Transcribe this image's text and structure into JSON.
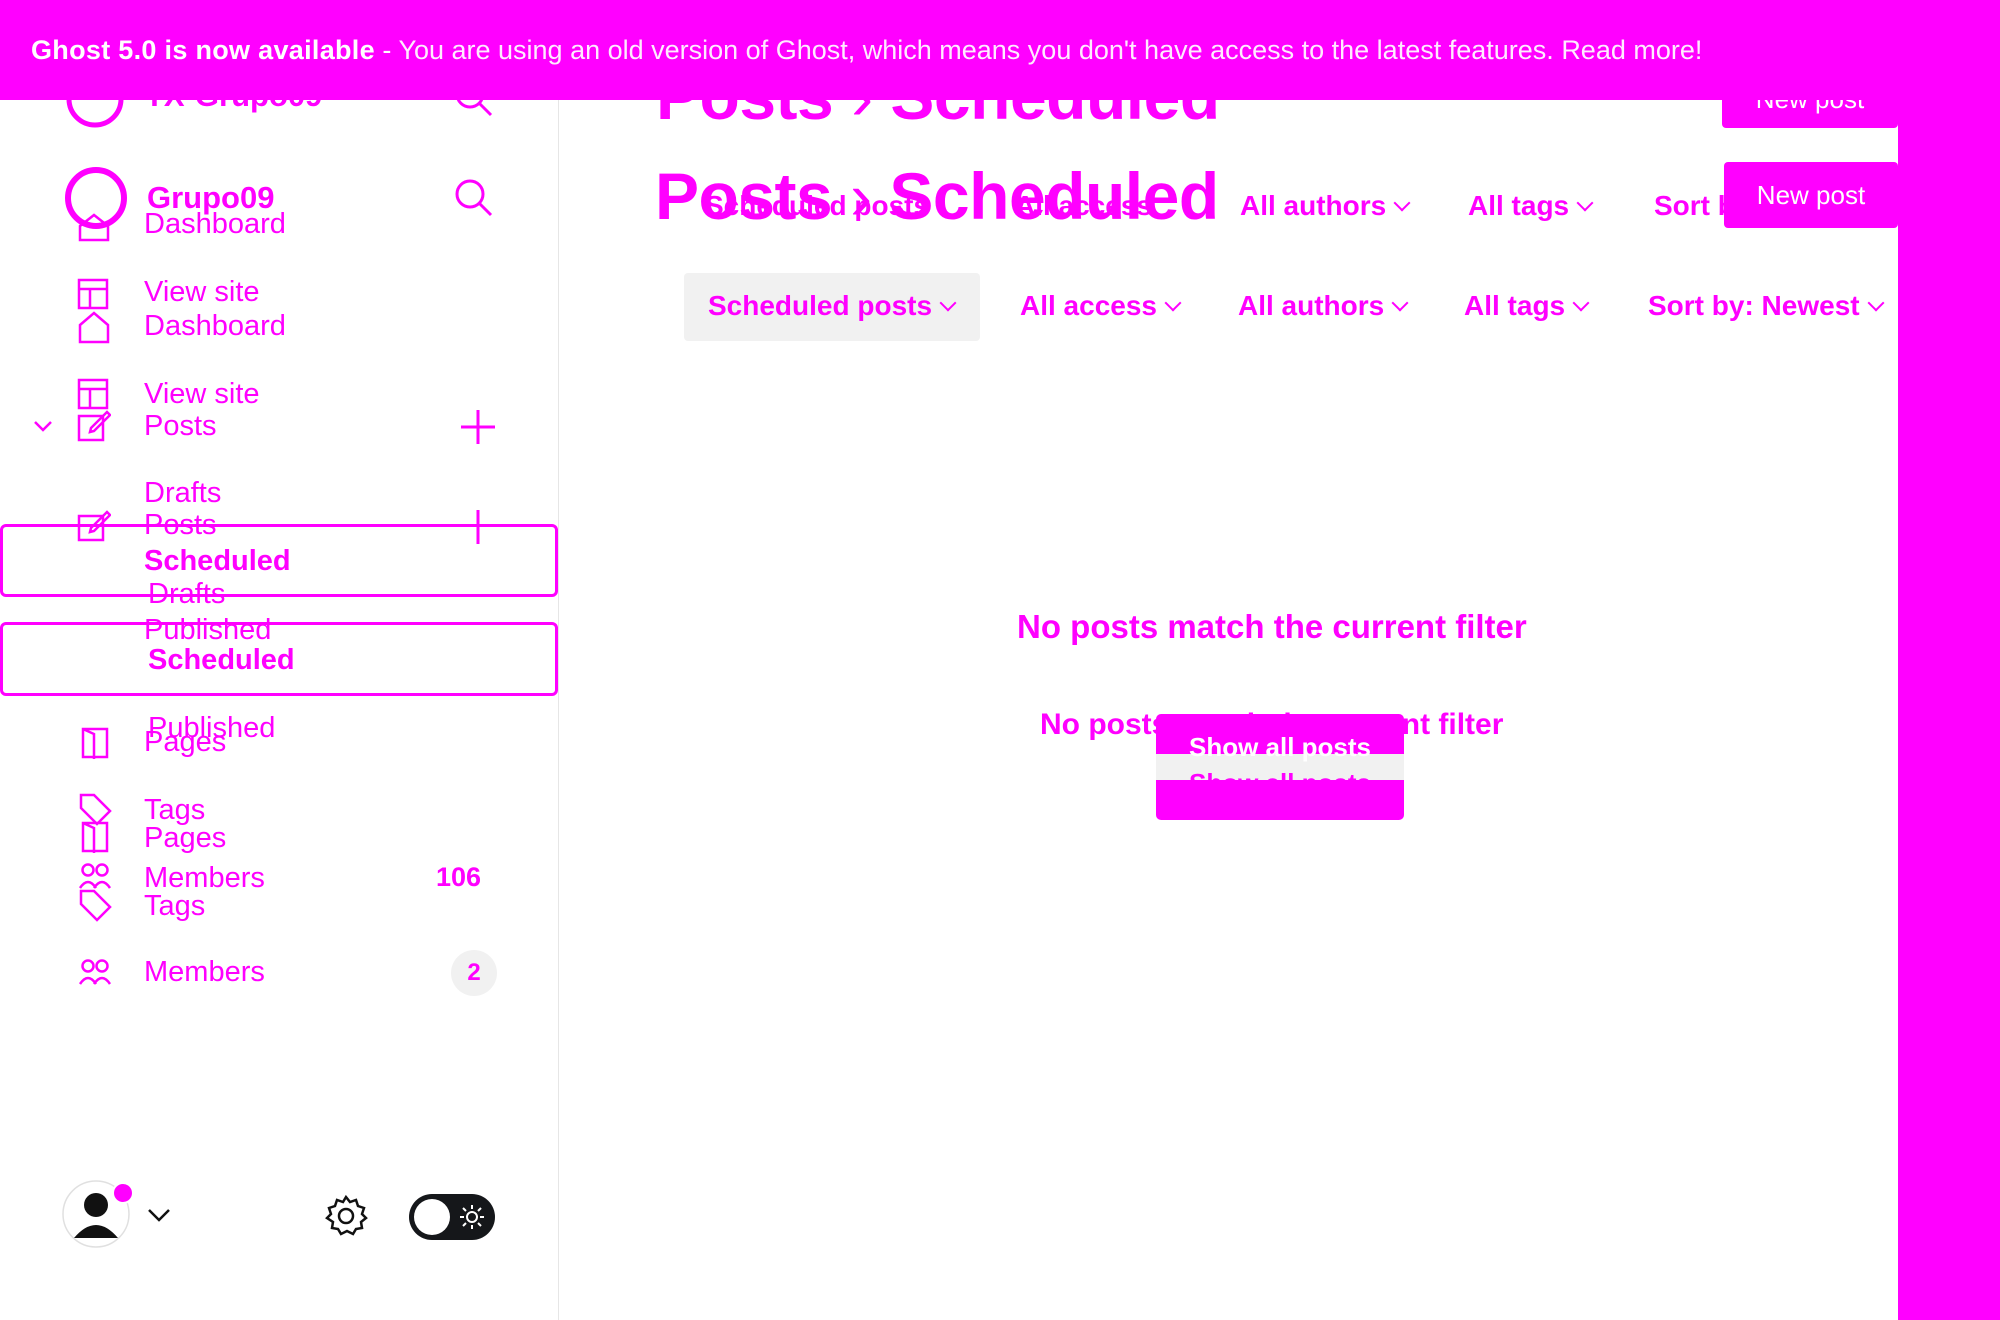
{
  "banner": {
    "title": "Ghost 5.0 is now available",
    "separator": " - ",
    "message": "You are using an old version of Ghost, which means you don't have access to the latest features.",
    "link": "Read more!"
  },
  "sidebar": {
    "site_name_ghost": "TX-Grupo09",
    "site_name": "Grupo09",
    "dashboard": "Dashboard",
    "view_site": "View site",
    "posts": "Posts",
    "drafts": "Drafts",
    "scheduled": "Scheduled",
    "published": "Published",
    "pages": "Pages",
    "tags": "Tags",
    "members": "Members",
    "members_count_ghost": "106",
    "members_count": "2"
  },
  "header": {
    "breadcrumb_parent": "Posts",
    "breadcrumb_separator": "›",
    "breadcrumb_current": "Scheduled",
    "new_post": "New post"
  },
  "filters": {
    "type": "Scheduled posts",
    "access": "All access",
    "authors": "All authors",
    "tags": "All tags",
    "sort": "Sort by: Newest",
    "sort_ghost": "Sort b"
  },
  "empty_state": {
    "message": "No posts match the current filter",
    "button": "Show all posts"
  },
  "colors": {
    "accent": "#ff00ff",
    "background": "#ffffff",
    "subtle_bg": "#f1f1f1"
  }
}
